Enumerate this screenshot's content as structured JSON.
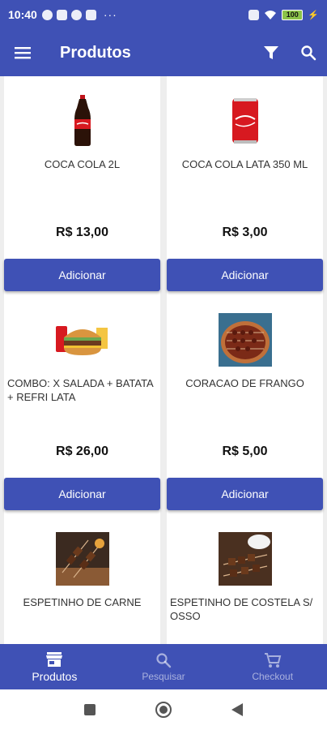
{
  "status_bar": {
    "time": "10:40",
    "battery": "100"
  },
  "app_bar": {
    "title": "Produtos",
    "menu_icon": "hamburger-icon",
    "filter_icon": "filter-icon",
    "search_icon": "search-icon"
  },
  "products": [
    {
      "name": "COCA COLA 2L",
      "price": "R$ 13,00",
      "button": "Adicionar",
      "image": "coca-cola-bottle"
    },
    {
      "name": "COCA COLA LATA 350 ML",
      "price": "R$ 3,00",
      "button": "Adicionar",
      "image": "coca-cola-can"
    },
    {
      "name": "COMBO: X SALADA + BATATA + REFRI LATA",
      "price": "R$ 26,00",
      "button": "Adicionar",
      "image": "burger-combo"
    },
    {
      "name": "CORACAO DE FRANGO",
      "price": "R$ 5,00",
      "button": "Adicionar",
      "image": "chicken-hearts-skewers"
    },
    {
      "name": "ESPETINHO DE CARNE",
      "price": "",
      "button": "",
      "image": "beef-skewers"
    },
    {
      "name": "ESPETINHO DE COSTELA S/ OSSO",
      "price": "",
      "button": "",
      "image": "rib-skewers"
    }
  ],
  "bottom_nav": [
    {
      "label": "Produtos",
      "icon": "store-icon",
      "active": true
    },
    {
      "label": "Pesquisar",
      "icon": "search-icon",
      "active": false
    },
    {
      "label": "Checkout",
      "icon": "cart-icon",
      "active": false
    }
  ],
  "colors": {
    "primary": "#3f51b5",
    "background": "#eeeeee",
    "card": "#ffffff"
  }
}
